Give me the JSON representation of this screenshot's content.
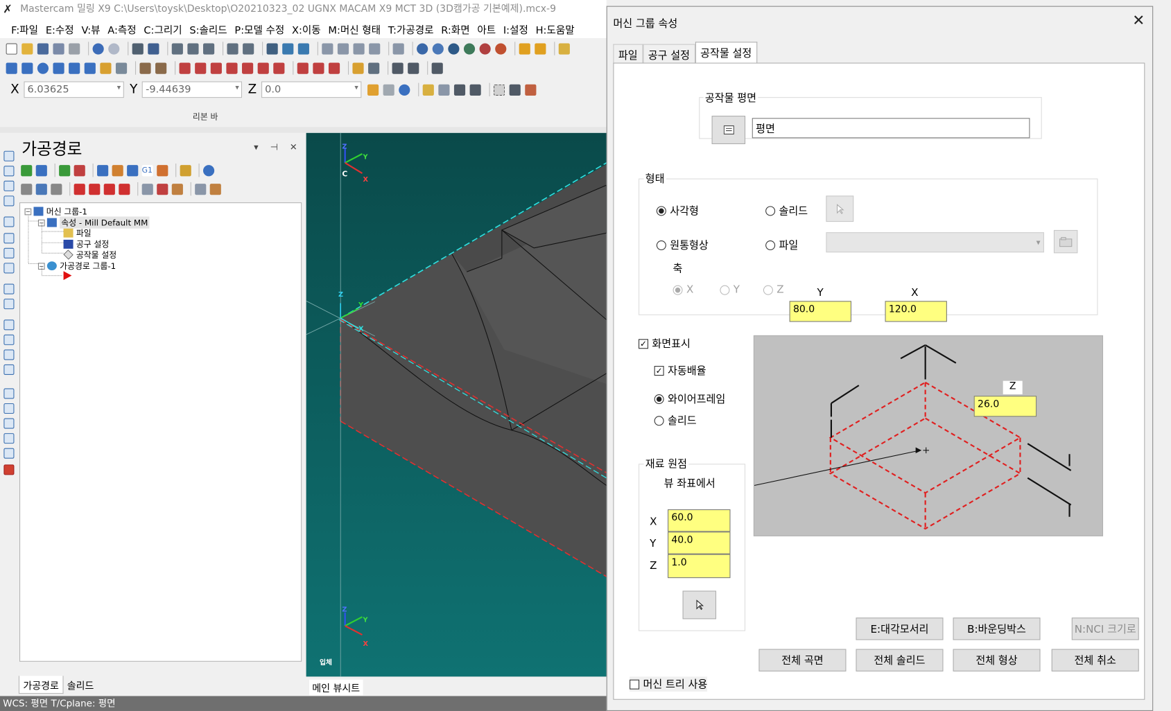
{
  "window": {
    "title": "Mastercam 밀링 X9  C:\\Users\\toysk\\Desktop\\O20210323_02 UGNX MACAM X9 MCT 3D (3D캠가공 기본예제).mcx-9"
  },
  "menu": [
    "F:파일",
    "E:수정",
    "V:뷰",
    "A:측정",
    "C:그리기",
    "S:솔리드",
    "P:모델 수정",
    "X:이동",
    "M:머신 형태",
    "T:가공경로",
    "R:화면",
    "아트",
    "I:설정",
    "H:도움말"
  ],
  "coords": {
    "x_label": "X",
    "x_value": "6.03625",
    "y_label": "Y",
    "y_value": "-9.44639",
    "z_label": "Z",
    "z_value": "0.0"
  },
  "ribbon_label": "리본 바",
  "panel": {
    "title": "가공경로",
    "tree": {
      "machine_group": "머신 그룹-1",
      "properties": "속성 - Mill Default MM",
      "files": "파일",
      "tool_settings": "공구 설정",
      "stock_setup": "공작물 설정",
      "toolpath_group": "가공경로 그룹-1"
    },
    "tabs": [
      "가공경로",
      "솔리드"
    ]
  },
  "viewport": {
    "axis_c": "C",
    "axis_x": "X",
    "axis_y": "Y",
    "axis_z": "Z",
    "view_label": "입체",
    "tab": "메인 뷰시트"
  },
  "status": {
    "text": "WCS: 평면   T/Cplane: 평면"
  },
  "dialog": {
    "title": "머신 그룹 속성",
    "close": "✕",
    "tabs": [
      "파일",
      "공구 설정",
      "공작물 설정"
    ],
    "stock_plane": {
      "label": "공작물 평면",
      "value": "평면"
    },
    "shape": {
      "label": "형태",
      "rect": "사각형",
      "solid": "솔리드",
      "cylinder": "원통형상",
      "file": "파일",
      "axis_label": "축",
      "axis_x": "X",
      "axis_y": "Y",
      "axis_z": "Z"
    },
    "dims": {
      "y_label": "Y",
      "y_value": "80.0",
      "x_label": "X",
      "x_value": "120.0",
      "z_label": "Z",
      "z_value": "26.0"
    },
    "display": {
      "label": "화면표시",
      "auto": "자동배율",
      "wireframe": "와이어프레임",
      "solid": "솔리드"
    },
    "origin": {
      "label": "재료 원점",
      "view_coords": "뷰 좌표에서",
      "x_label": "X",
      "x_value": "60.0",
      "y_label": "Y",
      "y_value": "40.0",
      "z_label": "Z",
      "z_value": "1.0"
    },
    "buttons": {
      "corners": "E:대각모서리",
      "bbox": "B:바운딩박스",
      "nci": "N:NCI 크기로",
      "all_surfaces": "전체 곡면",
      "all_solids": "전체 솔리드",
      "all_entities": "전체 형상",
      "all_cancel": "전체 취소"
    },
    "machine_tree": "머신 트리 사용"
  }
}
